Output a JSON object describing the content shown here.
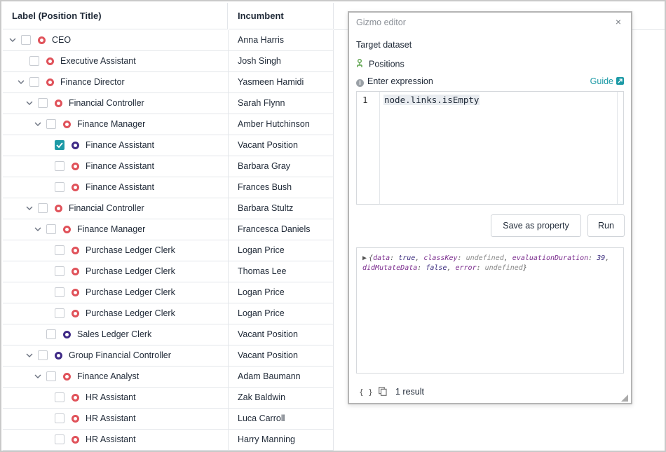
{
  "grid": {
    "columns": {
      "label": "Label (Position Title)",
      "incumbent": "Incumbent"
    },
    "rows": [
      {
        "label": "CEO",
        "incumbent": "Anna Harris",
        "level": 0,
        "expanded": true,
        "checked": false,
        "ring": "red"
      },
      {
        "label": "Executive Assistant",
        "incumbent": "Josh Singh",
        "level": 1,
        "expanded": null,
        "checked": false,
        "ring": "red"
      },
      {
        "label": "Finance Director",
        "incumbent": "Yasmeen Hamidi",
        "level": 1,
        "expanded": true,
        "checked": false,
        "ring": "red"
      },
      {
        "label": "Financial Controller",
        "incumbent": "Sarah Flynn",
        "level": 2,
        "expanded": true,
        "checked": false,
        "ring": "red"
      },
      {
        "label": "Finance Manager",
        "incumbent": "Amber Hutchinson",
        "level": 3,
        "expanded": true,
        "checked": false,
        "ring": "red"
      },
      {
        "label": "Finance Assistant",
        "incumbent": "Vacant Position",
        "level": 4,
        "expanded": null,
        "checked": true,
        "ring": "purple"
      },
      {
        "label": "Finance Assistant",
        "incumbent": "Barbara Gray",
        "level": 4,
        "expanded": null,
        "checked": false,
        "ring": "red"
      },
      {
        "label": "Finance Assistant",
        "incumbent": "Frances Bush",
        "level": 4,
        "expanded": null,
        "checked": false,
        "ring": "red"
      },
      {
        "label": "Financial Controller",
        "incumbent": "Barbara Stultz",
        "level": 2,
        "expanded": true,
        "checked": false,
        "ring": "red"
      },
      {
        "label": "Finance Manager",
        "incumbent": "Francesca Daniels",
        "level": 3,
        "expanded": true,
        "checked": false,
        "ring": "red"
      },
      {
        "label": "Purchase Ledger Clerk",
        "incumbent": "Logan Price",
        "level": 4,
        "expanded": null,
        "checked": false,
        "ring": "red"
      },
      {
        "label": "Purchase Ledger Clerk",
        "incumbent": "Thomas Lee",
        "level": 4,
        "expanded": null,
        "checked": false,
        "ring": "red"
      },
      {
        "label": "Purchase Ledger Clerk",
        "incumbent": "Logan Price",
        "level": 4,
        "expanded": null,
        "checked": false,
        "ring": "red"
      },
      {
        "label": "Purchase Ledger Clerk",
        "incumbent": "Logan Price",
        "level": 4,
        "expanded": null,
        "checked": false,
        "ring": "red"
      },
      {
        "label": "Sales Ledger Clerk",
        "incumbent": "Vacant Position",
        "level": 3,
        "expanded": null,
        "checked": false,
        "ring": "purple"
      },
      {
        "label": "Group Financial Controller",
        "incumbent": "Vacant Position",
        "level": 2,
        "expanded": true,
        "checked": false,
        "ring": "purple"
      },
      {
        "label": "Finance Analyst",
        "incumbent": "Adam Baumann",
        "level": 3,
        "expanded": true,
        "checked": false,
        "ring": "red"
      },
      {
        "label": "HR Assistant",
        "incumbent": "Zak Baldwin",
        "level": 4,
        "expanded": null,
        "checked": false,
        "ring": "red"
      },
      {
        "label": "HR Assistant",
        "incumbent": "Luca Carroll",
        "level": 4,
        "expanded": null,
        "checked": false,
        "ring": "red"
      },
      {
        "label": "HR Assistant",
        "incumbent": "Harry Manning",
        "level": 4,
        "expanded": null,
        "checked": false,
        "ring": "red"
      }
    ]
  },
  "dialog": {
    "title": "Gizmo editor",
    "close": "×",
    "target_dataset_label": "Target dataset",
    "dataset_name": "Positions",
    "dataset_icon": "person-tree-icon",
    "expression_label": "Enter expression",
    "guide_label": "Guide",
    "line_number": "1",
    "code": "node.links.isEmpty",
    "save_button": "Save as property",
    "run_button": "Run",
    "result": {
      "k1": "data",
      "v1": "true",
      "k2": "classKey",
      "v2": "undefined",
      "k3": "evaluationDuration",
      "v3": "39",
      "k4": "didMutateData",
      "v4": "false",
      "k5": "error",
      "v5": "undefined"
    },
    "footer_count": "1 result"
  },
  "colors": {
    "accent": "#1d9aa6",
    "ring_red": "#e0525a",
    "ring_purple": "#3f2a86"
  }
}
